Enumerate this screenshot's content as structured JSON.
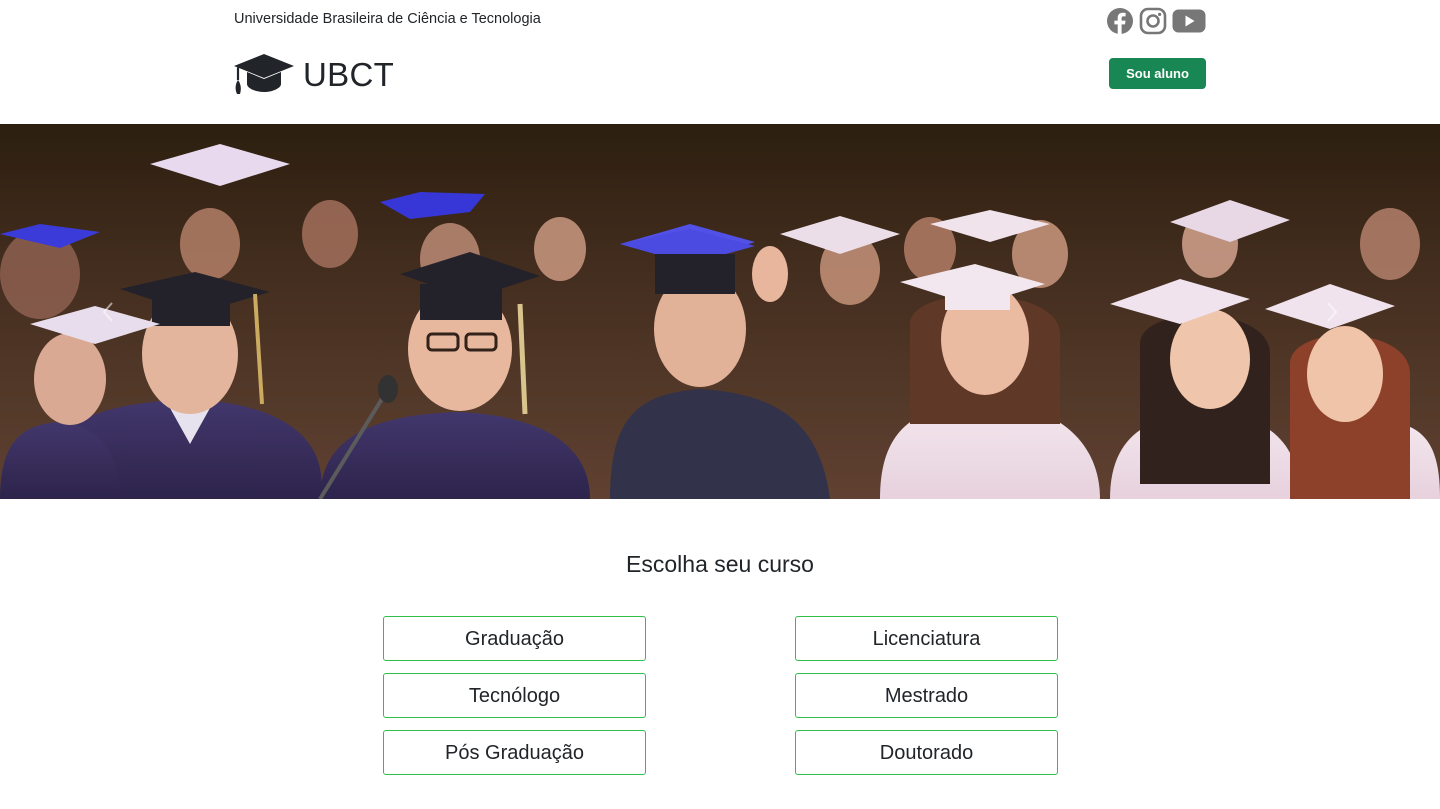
{
  "header": {
    "university_full_name": "Universidade Brasileira de Ciência e Tecnologia",
    "brand_name": "UBCT",
    "student_button_label": "Sou aluno",
    "social_icons": [
      "facebook-icon",
      "instagram-icon",
      "youtube-icon"
    ]
  },
  "hero": {
    "image_description_icon": "graduates-photo",
    "controls": [
      "previous",
      "next"
    ]
  },
  "courses": {
    "title": "Escolha seu curso",
    "items": [
      "Graduação",
      "Licenciatura",
      "Tecnólogo",
      "Mestrado",
      "Pós Graduação",
      "Doutorado"
    ]
  },
  "colors": {
    "primary_green": "#198754",
    "outline_green": "#2fbf4a",
    "text_dark": "#212529",
    "icon_gray": "#777777"
  }
}
